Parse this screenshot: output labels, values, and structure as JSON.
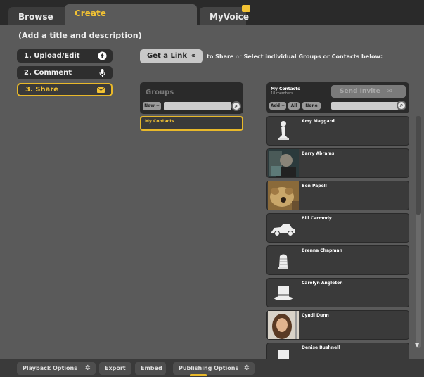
{
  "tabs": {
    "browse": "Browse",
    "create": "Create",
    "myvoice": "MyVoice"
  },
  "subtitle": "(Add a title and description)",
  "steps": [
    {
      "label": "1. Upload/Edit",
      "icon": "upload-icon"
    },
    {
      "label": "2. Comment",
      "icon": "microphone-icon"
    },
    {
      "label": "3. Share",
      "icon": "envelope-icon"
    }
  ],
  "share": {
    "get_link": "Get a Link",
    "to_share": "to Share",
    "or": "or",
    "select_text": "Select individual Groups or Contacts below:"
  },
  "groups": {
    "title": "Groups",
    "new_label": "New +",
    "search_placeholder": "",
    "items": [
      "My Contacts"
    ]
  },
  "contacts": {
    "title": "My Contacts",
    "count": "18 members",
    "send_invite": "Send Invite",
    "add_label": "Add +",
    "all_label": "All",
    "none_label": "None",
    "search_placeholder": "",
    "items": [
      {
        "name": "Amy Maggard",
        "avatar": "chess-pawn-icon"
      },
      {
        "name": "Barry Abrams",
        "avatar": "photo"
      },
      {
        "name": "Ben Papell",
        "avatar": "photo"
      },
      {
        "name": "Bill Carmody",
        "avatar": "car-icon"
      },
      {
        "name": "Brenna Chapman",
        "avatar": "thimble-icon"
      },
      {
        "name": "Carolyn Angleton",
        "avatar": "top-hat-icon"
      },
      {
        "name": "Cyndi Dunn",
        "avatar": "photo"
      },
      {
        "name": "Denise Bushnell",
        "avatar": "top-hat-icon"
      }
    ]
  },
  "bottom": {
    "playback": "Playback Options",
    "export": "Export",
    "embed": "Embed",
    "publishing": "Publishing Options"
  },
  "colors": {
    "accent": "#f2c233",
    "panel": "#2a2a2a",
    "background": "#5a5a5a"
  }
}
